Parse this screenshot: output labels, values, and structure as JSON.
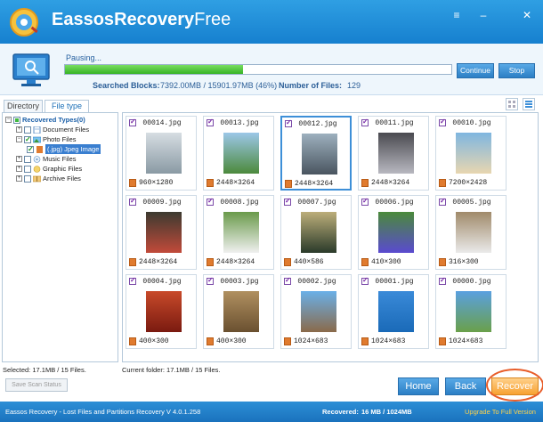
{
  "app": {
    "title_part1": "Eassos",
    "title_part2": "Recovery",
    "title_part3": "Free"
  },
  "window_controls": {
    "menu": "≡",
    "minimize": "–",
    "close": "✕"
  },
  "progress": {
    "status": "Pausing...",
    "fraction": 0.46,
    "searched_label": "Searched Blocks:",
    "searched_value": "7392.00MB / 15901.97MB (46%)",
    "files_label": "Number of Files:",
    "files_value": "129",
    "continue_label": "Continue",
    "stop_label": "Stop"
  },
  "tabs": {
    "directory": "Directory",
    "file_type": "File type"
  },
  "tree": {
    "root": "Recovered Types(0)",
    "document": "Document Files",
    "photo": "Photo Files",
    "jpeg": "(.jpg) Jpeg Image",
    "music": "Music Files",
    "graphic": "Graphic Files",
    "archive": "Archive Files"
  },
  "files": [
    {
      "name": "00014.jpg",
      "res": "960×1280"
    },
    {
      "name": "00013.jpg",
      "res": "2448×3264"
    },
    {
      "name": "00012.jpg",
      "res": "2448×3264"
    },
    {
      "name": "00011.jpg",
      "res": "2448×3264"
    },
    {
      "name": "00010.jpg",
      "res": "7200×2428"
    },
    {
      "name": "00009.jpg",
      "res": "2448×3264"
    },
    {
      "name": "00008.jpg",
      "res": "2448×3264"
    },
    {
      "name": "00007.jpg",
      "res": "440×586"
    },
    {
      "name": "00006.jpg",
      "res": "410×300"
    },
    {
      "name": "00005.jpg",
      "res": "316×300"
    },
    {
      "name": "00004.jpg",
      "res": "400×300"
    },
    {
      "name": "00003.jpg",
      "res": "400×300"
    },
    {
      "name": "00002.jpg",
      "res": "1024×683"
    },
    {
      "name": "00001.jpg",
      "res": "1024×683"
    },
    {
      "name": "00000.jpg",
      "res": "1024×683"
    }
  ],
  "footer": {
    "selected": "Selected: 17.1MB / 15 Files.",
    "current_folder": "Current folder: 17.1MB / 15 Files.",
    "save_scan": "Save Scan Status",
    "home": "Home",
    "back": "Back",
    "recover": "Recover"
  },
  "statusbar": {
    "product": "Eassos Recovery - Lost Files and Partitions Recovery  V 4.0.1.258",
    "recovered_label": "Recovered:",
    "recovered_value": "16 MB / 1024MB",
    "upgrade": "Upgrade To Full Version"
  },
  "colors": {
    "accent": "#1a7bd0",
    "progress": "#3fbf2a",
    "recover": "#f7a132",
    "upgrade": "#ffd24a"
  }
}
